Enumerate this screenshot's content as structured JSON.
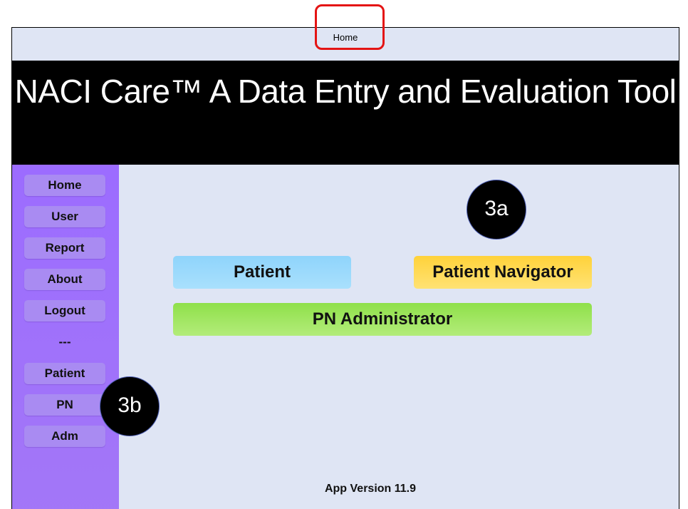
{
  "topbar": {
    "title": "Home"
  },
  "banner": {
    "title": "NACI Care™ A Data Entry and Evaluation Tool"
  },
  "sidebar": {
    "items": [
      {
        "label": "Home"
      },
      {
        "label": "User"
      },
      {
        "label": "Report"
      },
      {
        "label": "About"
      },
      {
        "label": "Logout"
      },
      {
        "label": "---"
      },
      {
        "label": "Patient"
      },
      {
        "label": "PN"
      },
      {
        "label": "Adm"
      }
    ]
  },
  "main": {
    "buttons": {
      "patient": "Patient",
      "navigator": "Patient Navigator",
      "admin": "PN Administrator"
    },
    "version": "App Version 11.9"
  },
  "callouts": {
    "a": "3a",
    "b": "3b"
  },
  "colors": {
    "highlight": "#e41414",
    "sidebar": "#9c6cff",
    "patient_button": "#8fd4fb",
    "navigator_button": "#ffd23a",
    "admin_button": "#8fe04a",
    "background": "#dfe5f4"
  }
}
